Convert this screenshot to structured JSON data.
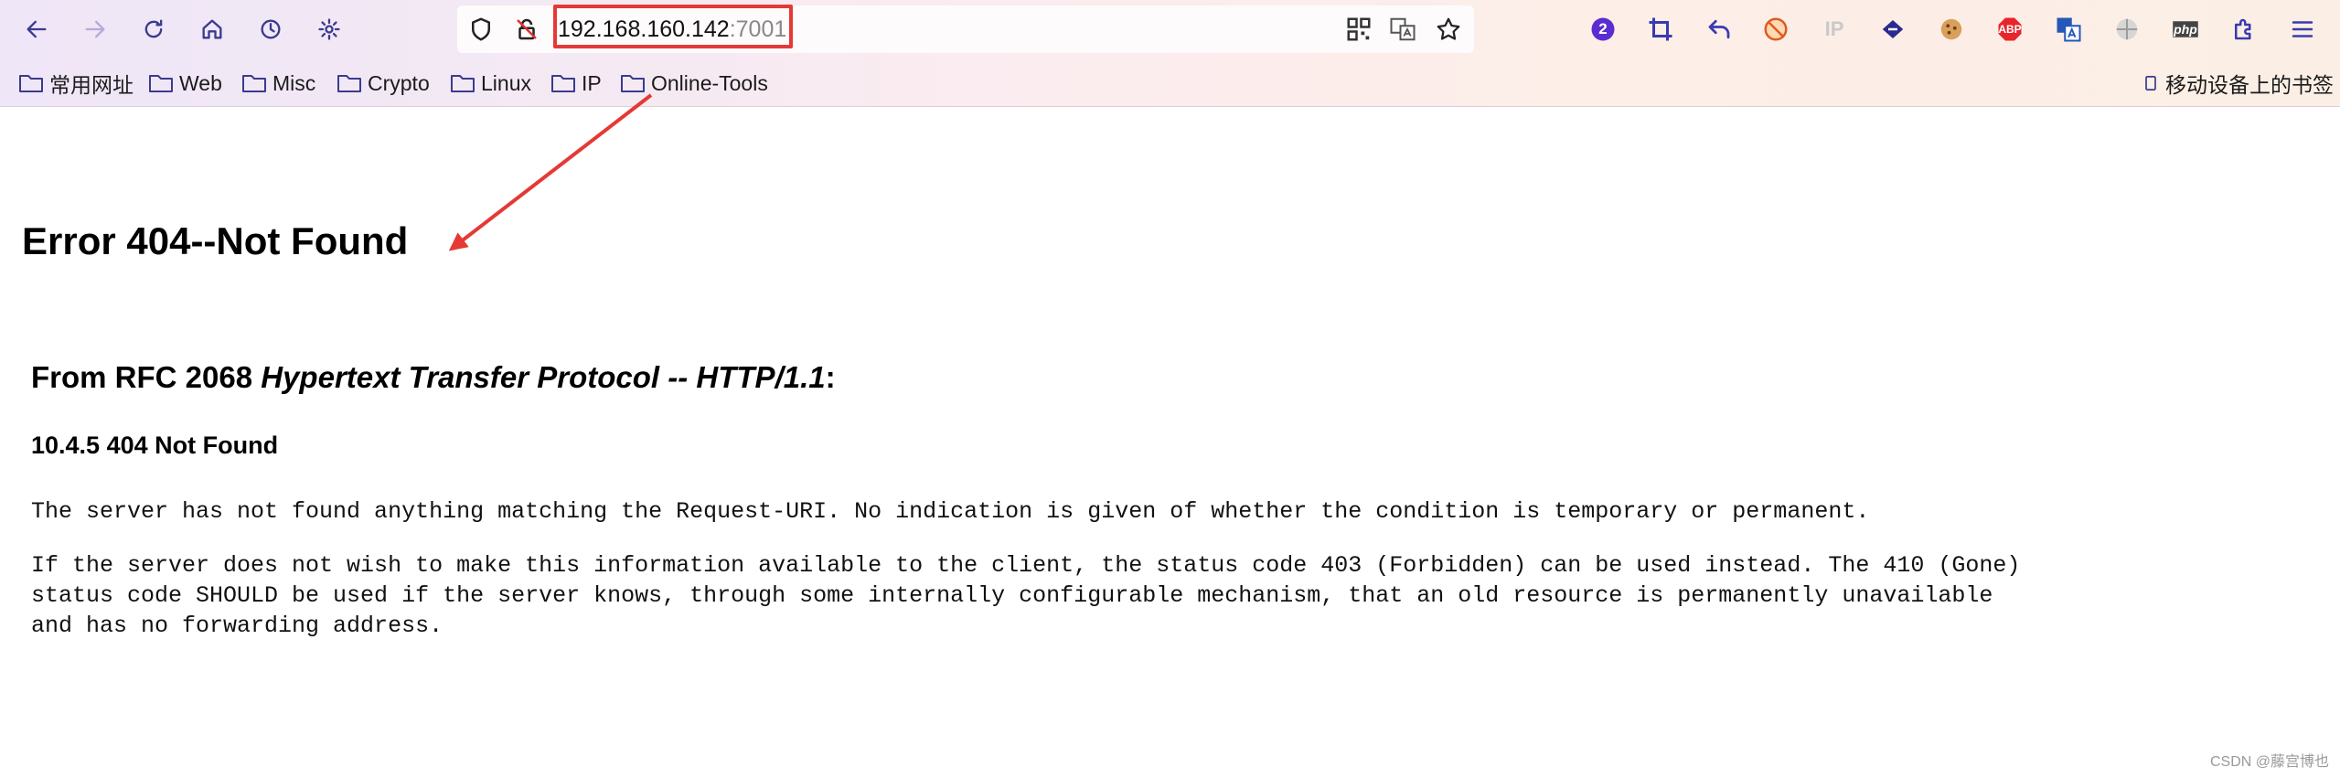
{
  "browser": {
    "url_host": "192.168.160.142",
    "url_port": ":7001",
    "notification_count": "2",
    "nav_icons": [
      "back-icon",
      "forward-icon",
      "reload-icon",
      "home-icon",
      "history-icon",
      "settings-icon"
    ],
    "bookmarks": [
      {
        "label": "常用网址"
      },
      {
        "label": "Web"
      },
      {
        "label": "Misc"
      },
      {
        "label": "Crypto"
      },
      {
        "label": "Linux"
      },
      {
        "label": "IP"
      },
      {
        "label": "Online-Tools"
      }
    ],
    "mobile_bookmarks": "移动设备上的书签",
    "ip_ext_label": "IP",
    "abp_label": "ABP",
    "php_label": "php"
  },
  "page": {
    "title": "Error 404--Not Found",
    "rfc_prefix": "From RFC 2068 ",
    "rfc_title": "Hypertext Transfer Protocol -- HTTP/1.1",
    "rfc_suffix": ":",
    "section": "10.4.5 404 Not Found",
    "para1": "The server has not found anything matching the Request-URI. No indication is given of whether the condition is temporary or permanent.",
    "para2_line1": "If the server does not wish to make this information available to the client, the status code 403 (Forbidden) can be used instead. The 410 (Gone)",
    "para2_line2": "status code SHOULD be used if the server knows, through some internally configurable mechanism, that an old resource is permanently unavailable",
    "para2_line3": "and has no forwarding address."
  },
  "watermark": "CSDN @藤宫博也",
  "colors": {
    "annotation_red": "#e53935",
    "accent_purple": "#5b2ccf"
  }
}
